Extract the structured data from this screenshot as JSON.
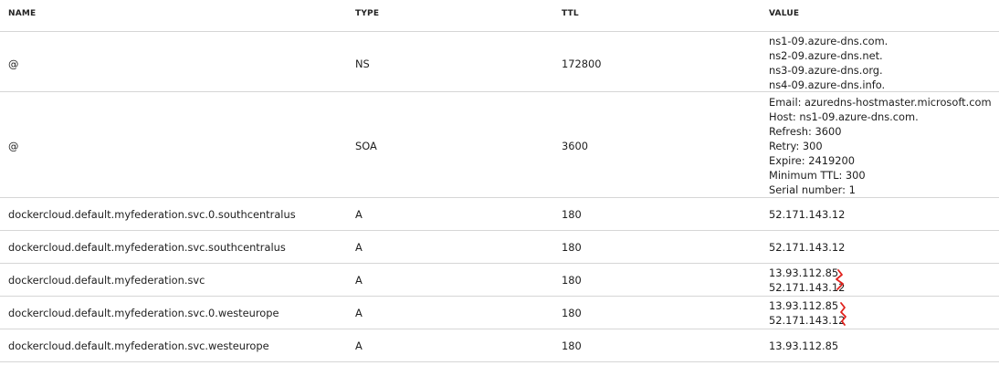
{
  "headers": {
    "name": "NAME",
    "type": "TYPE",
    "ttl": "TTL",
    "value": "VALUE"
  },
  "records": [
    {
      "name": "@",
      "type": "NS",
      "ttl": "172800",
      "values": [
        "ns1-09.azure-dns.com.",
        "ns2-09.azure-dns.net.",
        "ns3-09.azure-dns.org.",
        "ns4-09.azure-dns.info."
      ]
    },
    {
      "name": "@",
      "type": "SOA",
      "ttl": "3600",
      "values": [
        "Email: azuredns-hostmaster.microsoft.com",
        "Host: ns1-09.azure-dns.com.",
        "Refresh: 3600",
        "Retry: 300",
        "Expire: 2419200",
        "Minimum TTL: 300",
        "Serial number: 1"
      ]
    },
    {
      "name": "dockercloud.default.myfederation.svc.0.southcentralus",
      "type": "A",
      "ttl": "180",
      "values": [
        "52.171.143.12"
      ]
    },
    {
      "name": "dockercloud.default.myfederation.svc.southcentralus",
      "type": "A",
      "ttl": "180",
      "values": [
        "52.171.143.12"
      ]
    },
    {
      "name": "dockercloud.default.myfederation.svc",
      "type": "A",
      "ttl": "180",
      "values": [
        "13.93.112.85",
        "52.171.143.12"
      ]
    },
    {
      "name": "dockercloud.default.myfederation.svc.0.westeurope",
      "type": "A",
      "ttl": "180",
      "values": [
        "13.93.112.85",
        "52.171.143.12"
      ]
    },
    {
      "name": "dockercloud.default.myfederation.svc.westeurope",
      "type": "A",
      "ttl": "180",
      "values": [
        "13.93.112.85"
      ]
    }
  ],
  "annotation_color": "#e0201b"
}
